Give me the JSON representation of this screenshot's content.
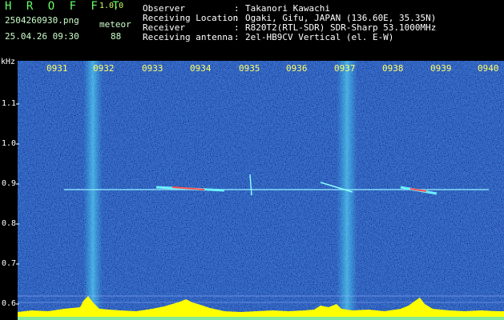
{
  "app": {
    "name": "H R O F F T",
    "version": "1.0.0"
  },
  "file": {
    "name": "2504260930.png",
    "datetime": "25.04.26 09:30"
  },
  "detection": {
    "label": "meteor",
    "count": "88"
  },
  "info": [
    {
      "label": "Observer",
      "sep": ":",
      "value": "Takanori Kawachi"
    },
    {
      "label": "Receiving Location",
      "sep": ":",
      "value": "Ogaki, Gifu, JAPAN (136.60E, 35.35N)"
    },
    {
      "label": "Receiver",
      "sep": ":",
      "value": "R820T2(RTL-SDR) SDR-Sharp 53.1000MHz"
    },
    {
      "label": "Receiving antenna",
      "sep": ":",
      "value": "2el-HB9CV Vertical (el. E-W)"
    }
  ],
  "axis": {
    "y_unit": "kHz",
    "y_ticks": [
      "1.1",
      "1.0",
      "0.9",
      "0.8",
      "0.7",
      "0.6"
    ],
    "x_ticks": [
      "0931",
      "0932",
      "0933",
      "0934",
      "0935",
      "0936",
      "0937",
      "0938",
      "0939",
      "0940"
    ]
  },
  "colors": {
    "background": "#000000",
    "tick_text": "#ffff66",
    "header_text": "#ccffcc",
    "title": "#66ff66"
  }
}
